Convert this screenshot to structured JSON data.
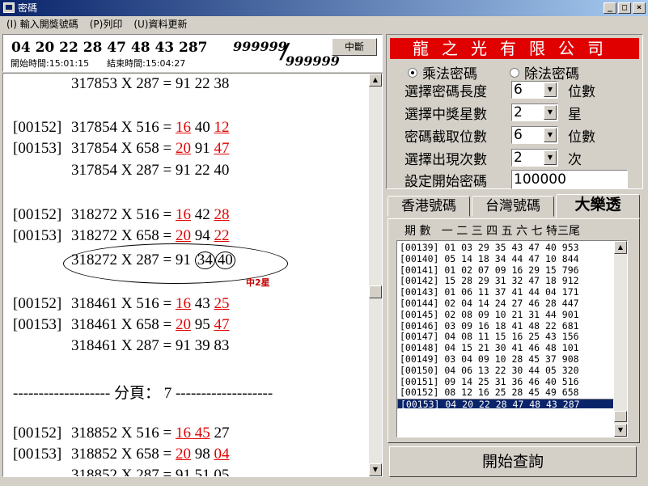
{
  "window": {
    "title": "密碼",
    "buttons": [
      "_",
      "□",
      "×"
    ]
  },
  "menu": {
    "items": [
      "(I) 輸入開獎號碼",
      "(P)列印",
      "(U)資料更新"
    ]
  },
  "header": {
    "numbers": "04 20 22 28 47 48 43 287",
    "start_time": "開始時間:15:01:15",
    "end_time": "結束時間:15:04:27",
    "progress_done": "999999",
    "progress_total": "999999",
    "stop_label": "中斷"
  },
  "results": {
    "r1": {
      "indent": "",
      "text": "317853 X 287 = 91 22 38"
    },
    "r2": {
      "id": "[00152]",
      "base": "317854 X 516 = ",
      "red1": "16",
      "mid": " 40 ",
      "red2": "12"
    },
    "r3": {
      "id": "[00153]",
      "base": "317854 X 658 = ",
      "red1": "20",
      "mid": " 91 ",
      "red2": "47"
    },
    "r4": {
      "text": "317854 X 287 = 91 22 40"
    },
    "r5": {
      "id": "[00152]",
      "base": "318272 X 516 = ",
      "red1": "16",
      "mid": " 42 ",
      "red2": "28"
    },
    "r6": {
      "id": "[00153]",
      "base": "318272 X 658 = ",
      "red1": "20",
      "mid": " 94 ",
      "red2": "22"
    },
    "r7": {
      "base": "318272 X 287 = 91",
      "c1": "34",
      "c2": "40"
    },
    "mark": "中2星",
    "r8": {
      "id": "[00152]",
      "base": "318461 X 516 = ",
      "red1": "16",
      "mid": " 43 ",
      "red2": "25"
    },
    "r9": {
      "id": "[00153]",
      "base": "318461 X 658 = ",
      "red1": "20",
      "mid": " 95 ",
      "red2": "47"
    },
    "r10": {
      "text": "318461 X 287 = 91 39 83"
    },
    "page_sep": "------------------- 分頁： 7 -------------------",
    "r11": {
      "id": "[00152]",
      "base": "318852 X 516 = ",
      "red1": "16 45",
      "mid": " 27",
      "red2": ""
    },
    "r12": {
      "id": "[00153]",
      "base": "318852 X 658 = ",
      "red1": "20",
      "mid": " 98 ",
      "red2": "04"
    },
    "r13": {
      "text": "318852 X 287 = 91 51 05"
    }
  },
  "right": {
    "company": "龍之光有限公司",
    "mode_multiply": "乘法密碼",
    "mode_divide": "除法密碼",
    "len_label": "選擇密碼長度",
    "len_value": "6",
    "len_unit": "位數",
    "star_label": "選擇中獎星數",
    "star_value": "2",
    "star_unit": "星",
    "cut_label": "密碼截取位數",
    "cut_value": "6",
    "cut_unit": "位數",
    "times_label": "選擇出現次數",
    "times_value": "2",
    "times_unit": "次",
    "start_label": "設定開始密碼",
    "start_value": "100000",
    "tabs": [
      "香港號碼",
      "台灣號碼",
      "大樂透"
    ],
    "list_header": "期 數   一 二 三 四 五 六 七 特三尾",
    "rows": [
      "[00139] 01 03 29 35 43 47 40 953",
      "[00140] 05 14 18 34 44 47 10 844",
      "[00141] 01 02 07 09 16 29 15 796",
      "[00142] 15 28 29 31 32 47 18 912",
      "[00143] 01 06 11 37 41 44 04 171",
      "[00144] 02 04 14 24 27 46 28 447",
      "[00145] 02 08 09 10 21 31 44 901",
      "[00146] 03 09 16 18 41 48 22 681",
      "[00147] 04 08 11 15 16 25 43 156",
      "[00148] 04 15 21 30 41 46 48 101",
      "[00149] 03 04 09 10 28 45 37 908",
      "[00150] 04 06 13 22 30 44 05 320",
      "[00151] 09 14 25 31 36 46 40 516",
      "[00152] 08 12 16 25 28 45 49 658",
      "[00153] 04 20 22 28 47 48 43 287"
    ],
    "query_label": "開始查詢"
  }
}
